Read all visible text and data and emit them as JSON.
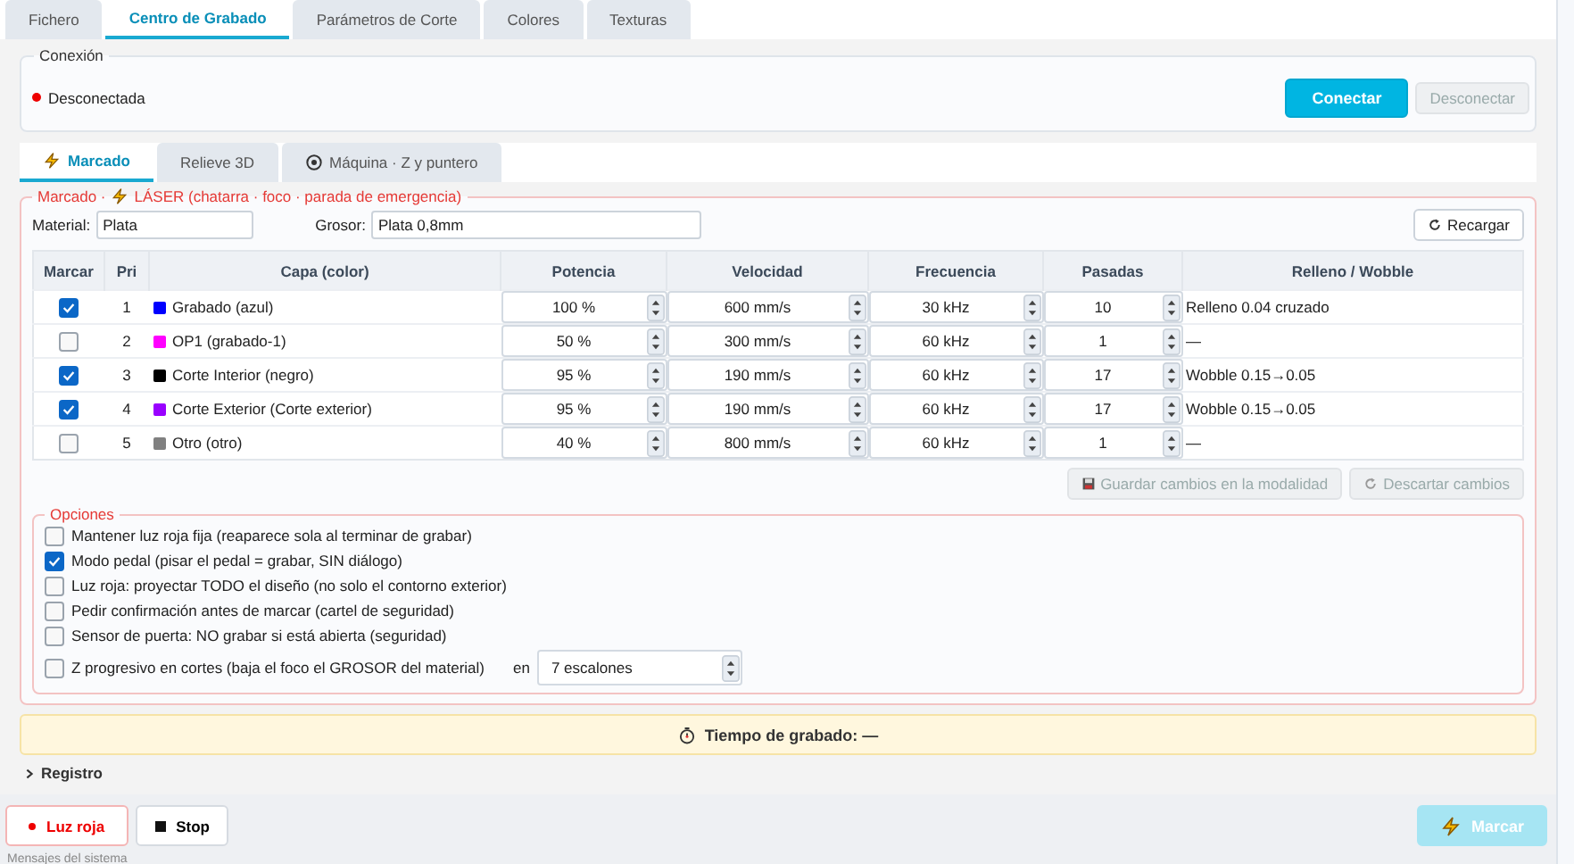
{
  "tabs": [
    {
      "label": "Fichero",
      "selected": false
    },
    {
      "label": "Centro de Grabado",
      "selected": true
    },
    {
      "label": "Parámetros de Corte",
      "selected": false
    },
    {
      "label": "Colores",
      "selected": false
    },
    {
      "label": "Texturas",
      "selected": false
    }
  ],
  "connection": {
    "title": "Conexión",
    "status": "Desconectada",
    "connected": false,
    "buttons": [
      {
        "label": "Conectar",
        "kind": "primary",
        "disabled": false
      },
      {
        "label": "Desconectar",
        "kind": "plain",
        "disabled": true
      }
    ]
  },
  "subtabs": [
    {
      "label": "Marcado",
      "kind": "bolt",
      "selected": true
    },
    {
      "label": "Relieve 3D",
      "kind": "plain",
      "selected": false
    },
    {
      "label": "Máquina · Z y puntero",
      "kind": "target",
      "selected": false
    }
  ],
  "marking": {
    "legend_prefix": "Marcado ·",
    "legend": "LÁSER (chatarra · foco · parada de emergencia)",
    "material_label": "Material:",
    "material": "Plata",
    "thickness_label": "Grosor:",
    "thickness": "Plata 0,8mm",
    "reload": "Recargar",
    "table": {
      "columns": [
        "Marcar",
        "Pri",
        "Capa (color)",
        "Potencia",
        "Velocidad",
        "Frecuencia",
        "Pasadas",
        "Relleno / Wobble"
      ],
      "rows": [
        {
          "checked": true,
          "pri": "1",
          "color": "#0000ff",
          "layer": "Grabado (azul)",
          "power": "100 %",
          "speed": "600 mm/s",
          "freq": "30 kHz",
          "passes": "10",
          "fill": "Relleno 0.04 cruzado"
        },
        {
          "checked": false,
          "pri": "2",
          "color": "#ff00ff",
          "layer": "OP1 (grabado-1)",
          "power": "50 %",
          "speed": "300 mm/s",
          "freq": "60 kHz",
          "passes": "1",
          "fill": "—"
        },
        {
          "checked": true,
          "pri": "3",
          "color": "#000000",
          "layer": "Corte Interior (negro)",
          "power": "95 %",
          "speed": "190 mm/s",
          "freq": "60 kHz",
          "passes": "17",
          "fill": "Wobble 0.15→0.05"
        },
        {
          "checked": true,
          "pri": "4",
          "color": "#9900ff",
          "layer": "Corte Exterior (Corte exterior)",
          "power": "95 %",
          "speed": "190 mm/s",
          "freq": "60 kHz",
          "passes": "17",
          "fill": "Wobble 0.15→0.05"
        },
        {
          "checked": false,
          "pri": "5",
          "color": "#808080",
          "layer": "Otro (otro)",
          "power": "40 %",
          "speed": "800 mm/s",
          "freq": "60 kHz",
          "passes": "1",
          "fill": "—"
        }
      ]
    },
    "save": {
      "label": "Guardar cambios en la modalidad",
      "disabled": true
    },
    "discard": {
      "label": "Descartar cambios",
      "disabled": true
    },
    "options_title": "Opciones",
    "options": [
      {
        "label": "Mantener luz roja fija (reaparece sola al terminar de grabar)",
        "checked": false
      },
      {
        "label": "Modo pedal (pisar el pedal = grabar, SIN diálogo)",
        "checked": true
      },
      {
        "label": "Luz roja: proyectar TODO el diseño (no solo el contorno exterior)",
        "checked": false
      },
      {
        "label": "Pedir confirmación antes de marcar (cartel de seguridad)",
        "checked": false
      },
      {
        "label": "Sensor de puerta: NO grabar si está abierta (seguridad)",
        "checked": false
      },
      {
        "label": "Z progresivo en cortes (baja el foco el GROSOR del material)",
        "checked": false,
        "suffix": "en",
        "value": "7 escalones"
      }
    ]
  },
  "timer": "Tiempo de grabado: —",
  "log": {
    "label": "Registro",
    "expanded": false
  },
  "footer": {
    "red_light": "Luz roja",
    "stop": "Stop",
    "mark": {
      "label": "Marcar",
      "disabled": true
    }
  },
  "status_caption": "Mensajes del sistema"
}
